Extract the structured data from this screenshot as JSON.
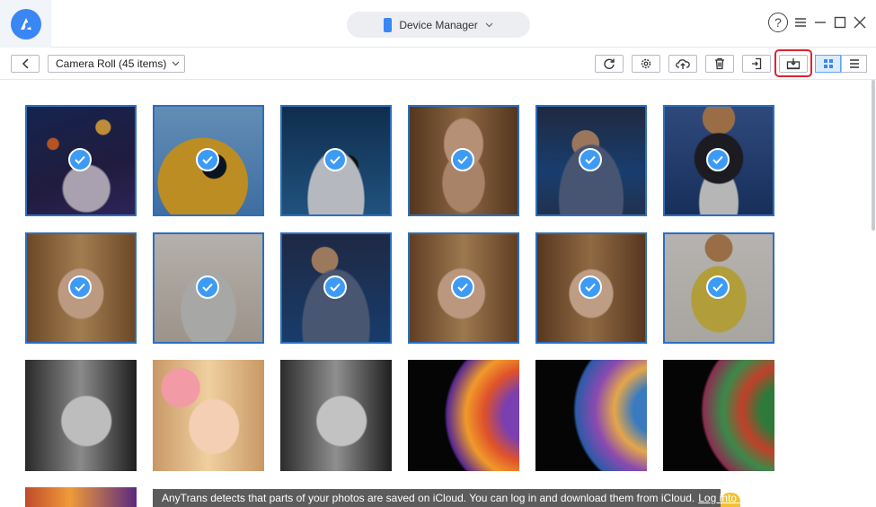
{
  "header": {
    "device_label": "Device Manager",
    "logo_glyph": "a"
  },
  "toolbar": {
    "album_label": "Camera Roll (45 items)",
    "actions": [
      "refresh-icon",
      "settings-icon",
      "cloud-upload-icon",
      "trash-icon",
      "export-icon",
      "download-to-computer-icon"
    ],
    "view_mode": "grid"
  },
  "colors": {
    "accent": "#3a86f4",
    "highlight_border": "#e0212f",
    "selection": "#3a8ef0"
  },
  "photos": [
    {
      "id": "p1",
      "selected": true
    },
    {
      "id": "p2",
      "selected": true
    },
    {
      "id": "p3",
      "selected": true
    },
    {
      "id": "p4",
      "selected": true
    },
    {
      "id": "p5",
      "selected": true
    },
    {
      "id": "p6",
      "selected": true
    },
    {
      "id": "p7",
      "selected": true
    },
    {
      "id": "p8",
      "selected": true
    },
    {
      "id": "p9",
      "selected": true
    },
    {
      "id": "p10",
      "selected": true
    },
    {
      "id": "p11",
      "selected": true
    },
    {
      "id": "p12",
      "selected": true
    },
    {
      "id": "p13",
      "selected": false
    },
    {
      "id": "p14",
      "selected": false
    },
    {
      "id": "p15",
      "selected": false
    },
    {
      "id": "p16",
      "selected": false
    },
    {
      "id": "p17",
      "selected": false
    },
    {
      "id": "p18",
      "selected": false
    }
  ],
  "notice": {
    "text": "AnyTrans detects that parts of your photos are saved on iCloud. You can log in and download them from iCloud.",
    "link": "Log into iCloud >"
  }
}
